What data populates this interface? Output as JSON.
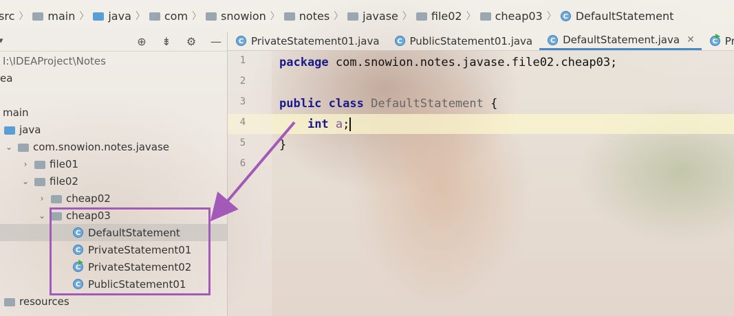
{
  "breadcrumb": [
    "src",
    "main",
    "java",
    "com",
    "snowion",
    "notes",
    "javase",
    "file02",
    "cheap03",
    "DefaultStatement"
  ],
  "project": {
    "path": "I:\\IDEAProject\\Notes",
    "row_idea": "ea",
    "tree": {
      "main": "main",
      "java": "java",
      "package": "com.snowion.notes.javase",
      "file01": "file01",
      "file02": "file02",
      "cheap02": "cheap02",
      "cheap03": "cheap03",
      "classes": [
        "DefaultStatement",
        "PrivateStatement01",
        "PrivateStatement02",
        "PublicStatement01"
      ],
      "resources": "resources"
    },
    "toolbar_icons": [
      "locate-icon",
      "collapse-icon",
      "gear-icon",
      "minimize-icon"
    ]
  },
  "tabs": [
    {
      "label": "PrivateStatement01.java",
      "active": false
    },
    {
      "label": "PublicStatement01.java",
      "active": false
    },
    {
      "label": "DefaultStatement.java",
      "active": true
    },
    {
      "label": "Pri",
      "active": false
    }
  ],
  "editor": {
    "line_numbers": [
      "1",
      "2",
      "3",
      "4",
      "5",
      "6"
    ],
    "line1": {
      "kw": "package",
      "rest": " com.snowion.notes.javase.file02.cheap03;"
    },
    "line3": {
      "kw1": "public",
      "kw2": "class",
      "name": "DefaultStatement",
      "brace": " {"
    },
    "line4": {
      "kw": "int",
      "field": "a",
      "end": ";"
    },
    "line5": "}"
  },
  "colors": {
    "highlight": "#a259b8",
    "active_tab": "#4a88c7",
    "keyword": "#1a1a8b"
  }
}
